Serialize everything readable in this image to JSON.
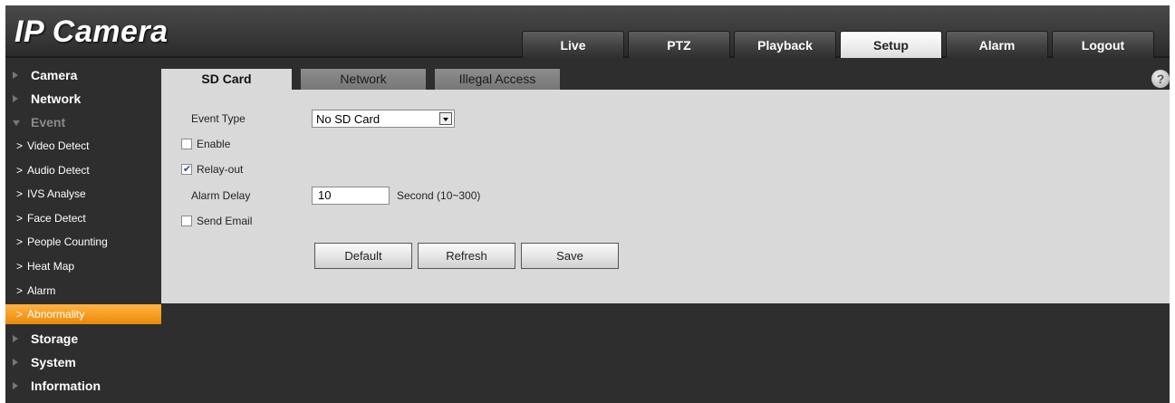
{
  "app": {
    "logo": "IP Camera"
  },
  "topnav": {
    "tabs": [
      {
        "label": "Live"
      },
      {
        "label": "PTZ"
      },
      {
        "label": "Playback"
      },
      {
        "label": "Setup",
        "active": true
      },
      {
        "label": "Alarm"
      },
      {
        "label": "Logout"
      }
    ]
  },
  "sidebar": {
    "camera": "Camera",
    "network": "Network",
    "event": "Event",
    "event_items": [
      "Video Detect",
      "Audio Detect",
      "IVS Analyse",
      "Face Detect",
      "People Counting",
      "Heat Map",
      "Alarm",
      "Abnormality"
    ],
    "storage": "Storage",
    "system": "System",
    "information": "Information"
  },
  "subtabs": {
    "sd_card": "SD Card",
    "network": "Network",
    "illegal_access": "Illegal Access",
    "help": "?"
  },
  "form": {
    "event_type_label": "Event Type",
    "event_type_value": "No SD Card",
    "enable_label": "Enable",
    "enable_checked": false,
    "relay_out_label": "Relay-out",
    "relay_out_checked": true,
    "alarm_delay_label": "Alarm Delay",
    "alarm_delay_value": "10",
    "alarm_delay_unit": "Second (10~300)",
    "send_email_label": "Send Email",
    "send_email_checked": false
  },
  "buttons": {
    "default": "Default",
    "refresh": "Refresh",
    "save": "Save"
  },
  "colors": {
    "accent_active": "#f59a1e",
    "background": "#2e2e2e",
    "panel": "#d9d9d9"
  }
}
